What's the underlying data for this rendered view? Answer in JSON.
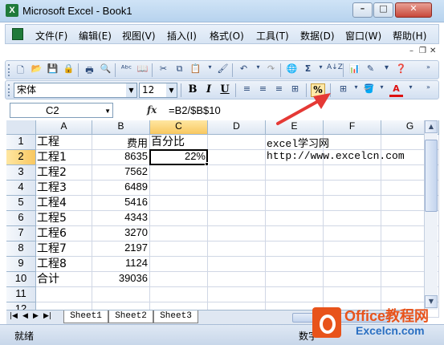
{
  "window": {
    "title": "Microsoft Excel - Book1",
    "app_icon": "excel-icon"
  },
  "menu": {
    "items": [
      "文件(F)",
      "编辑(E)",
      "视图(V)",
      "插入(I)",
      "格式(O)",
      "工具(T)",
      "数据(D)",
      "窗口(W)",
      "帮助(H)"
    ]
  },
  "format_toolbar": {
    "font_name": "宋体",
    "font_size": "12",
    "bold": "B",
    "italic": "I",
    "underline": "U",
    "percent": "%"
  },
  "formula_bar": {
    "name_box": "C2",
    "fx": "fx",
    "formula": "=B2/$B$10"
  },
  "grid": {
    "columns": [
      "A",
      "B",
      "C",
      "D",
      "E",
      "F",
      "G"
    ],
    "rows": [
      "1",
      "2",
      "3",
      "4",
      "5",
      "6",
      "7",
      "8",
      "9",
      "10",
      "11",
      "12"
    ],
    "cells": {
      "A1": "工程",
      "B1": "费用",
      "C1": "百分比",
      "E1": "excel学习网",
      "A2": "工程1",
      "B2": "8635",
      "C2": "22%",
      "E2": "http://www.excelcn.com",
      "A3": "工程2",
      "B3": "7562",
      "A4": "工程3",
      "B4": "6489",
      "A5": "工程4",
      "B5": "5416",
      "A6": "工程5",
      "B6": "4343",
      "A7": "工程6",
      "B7": "3270",
      "A8": "工程7",
      "B8": "2197",
      "A9": "工程8",
      "B9": "1124",
      "A10": "合计",
      "B10": "39036"
    },
    "active_cell": "C2"
  },
  "sheets": {
    "tabs": [
      "Sheet1",
      "Sheet2",
      "Sheet3"
    ],
    "active": "Sheet2"
  },
  "status": {
    "left": "就绪",
    "right": "数字"
  },
  "watermark": {
    "title": "Office教程网",
    "subtitle": "Excelcn.com"
  },
  "colors": {
    "annotation_arrow": "#e53935",
    "selection_border": "#000000",
    "header_active": "#f8c760"
  }
}
